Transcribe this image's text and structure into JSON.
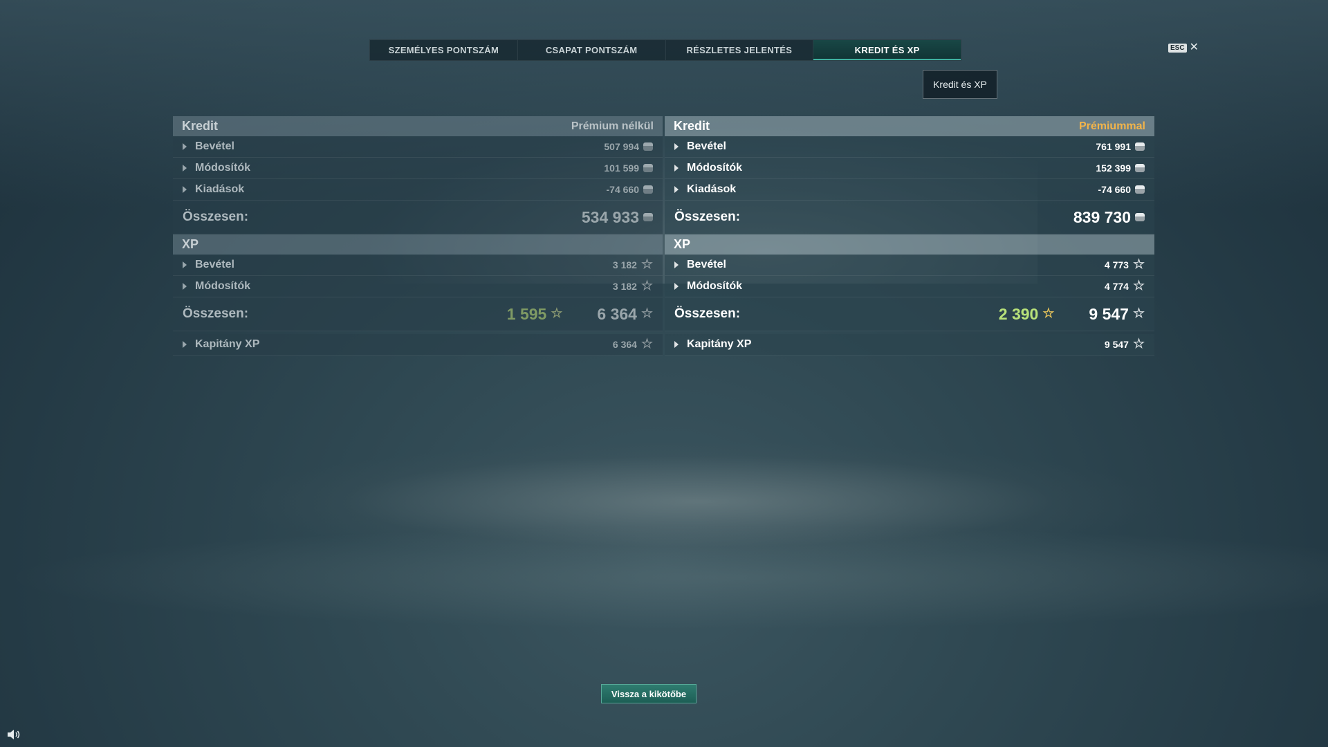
{
  "tabs": [
    {
      "label": "SZEMÉLYES PONTSZÁM"
    },
    {
      "label": "CSAPAT PONTSZÁM"
    },
    {
      "label": "RÉSZLETES JELENTÉS"
    },
    {
      "label": "KREDIT ÉS XP"
    }
  ],
  "esc": {
    "key": "ESC",
    "close": "✕"
  },
  "tooltip": "Kredit és XP",
  "left": {
    "credit_title": "Kredit",
    "credit_sub": "Prémium nélkül",
    "credit_rows": [
      {
        "label": "Bevétel",
        "value": "507 994"
      },
      {
        "label": "Módosítók",
        "value": "101 599"
      },
      {
        "label": "Kiadások",
        "value": "-74 660"
      }
    ],
    "credit_total_label": "Összesen:",
    "credit_total": "534 933",
    "xp_title": "XP",
    "xp_rows": [
      {
        "label": "Bevétel",
        "value": "3 182"
      },
      {
        "label": "Módosítók",
        "value": "3 182"
      }
    ],
    "xp_total_label": "Összesen:",
    "xp_free": "1 595",
    "xp_total": "6 364",
    "captain_label": "Kapitány XP",
    "captain_value": "6 364"
  },
  "right": {
    "credit_title": "Kredit",
    "credit_sub": "Prémiummal",
    "credit_rows": [
      {
        "label": "Bevétel",
        "value": "761 991"
      },
      {
        "label": "Módosítók",
        "value": "152 399"
      },
      {
        "label": "Kiadások",
        "value": "-74 660"
      }
    ],
    "credit_total_label": "Összesen:",
    "credit_total": "839 730",
    "xp_title": "XP",
    "xp_rows": [
      {
        "label": "Bevétel",
        "value": "4 773"
      },
      {
        "label": "Módosítók",
        "value": "4 774"
      }
    ],
    "xp_total_label": "Összesen:",
    "xp_free": "2 390",
    "xp_total": "9 547",
    "captain_label": "Kapitány XP",
    "captain_value": "9 547"
  },
  "back_button": "Vissza a kikötőbe",
  "colors": {
    "accent": "#3fb1a0",
    "premium": "#f2b44b",
    "free_xp_green": "#b8e27a"
  },
  "icons": {
    "credit": "credit-coin-icon",
    "xp": "star-icon",
    "sound": "speaker-icon"
  }
}
